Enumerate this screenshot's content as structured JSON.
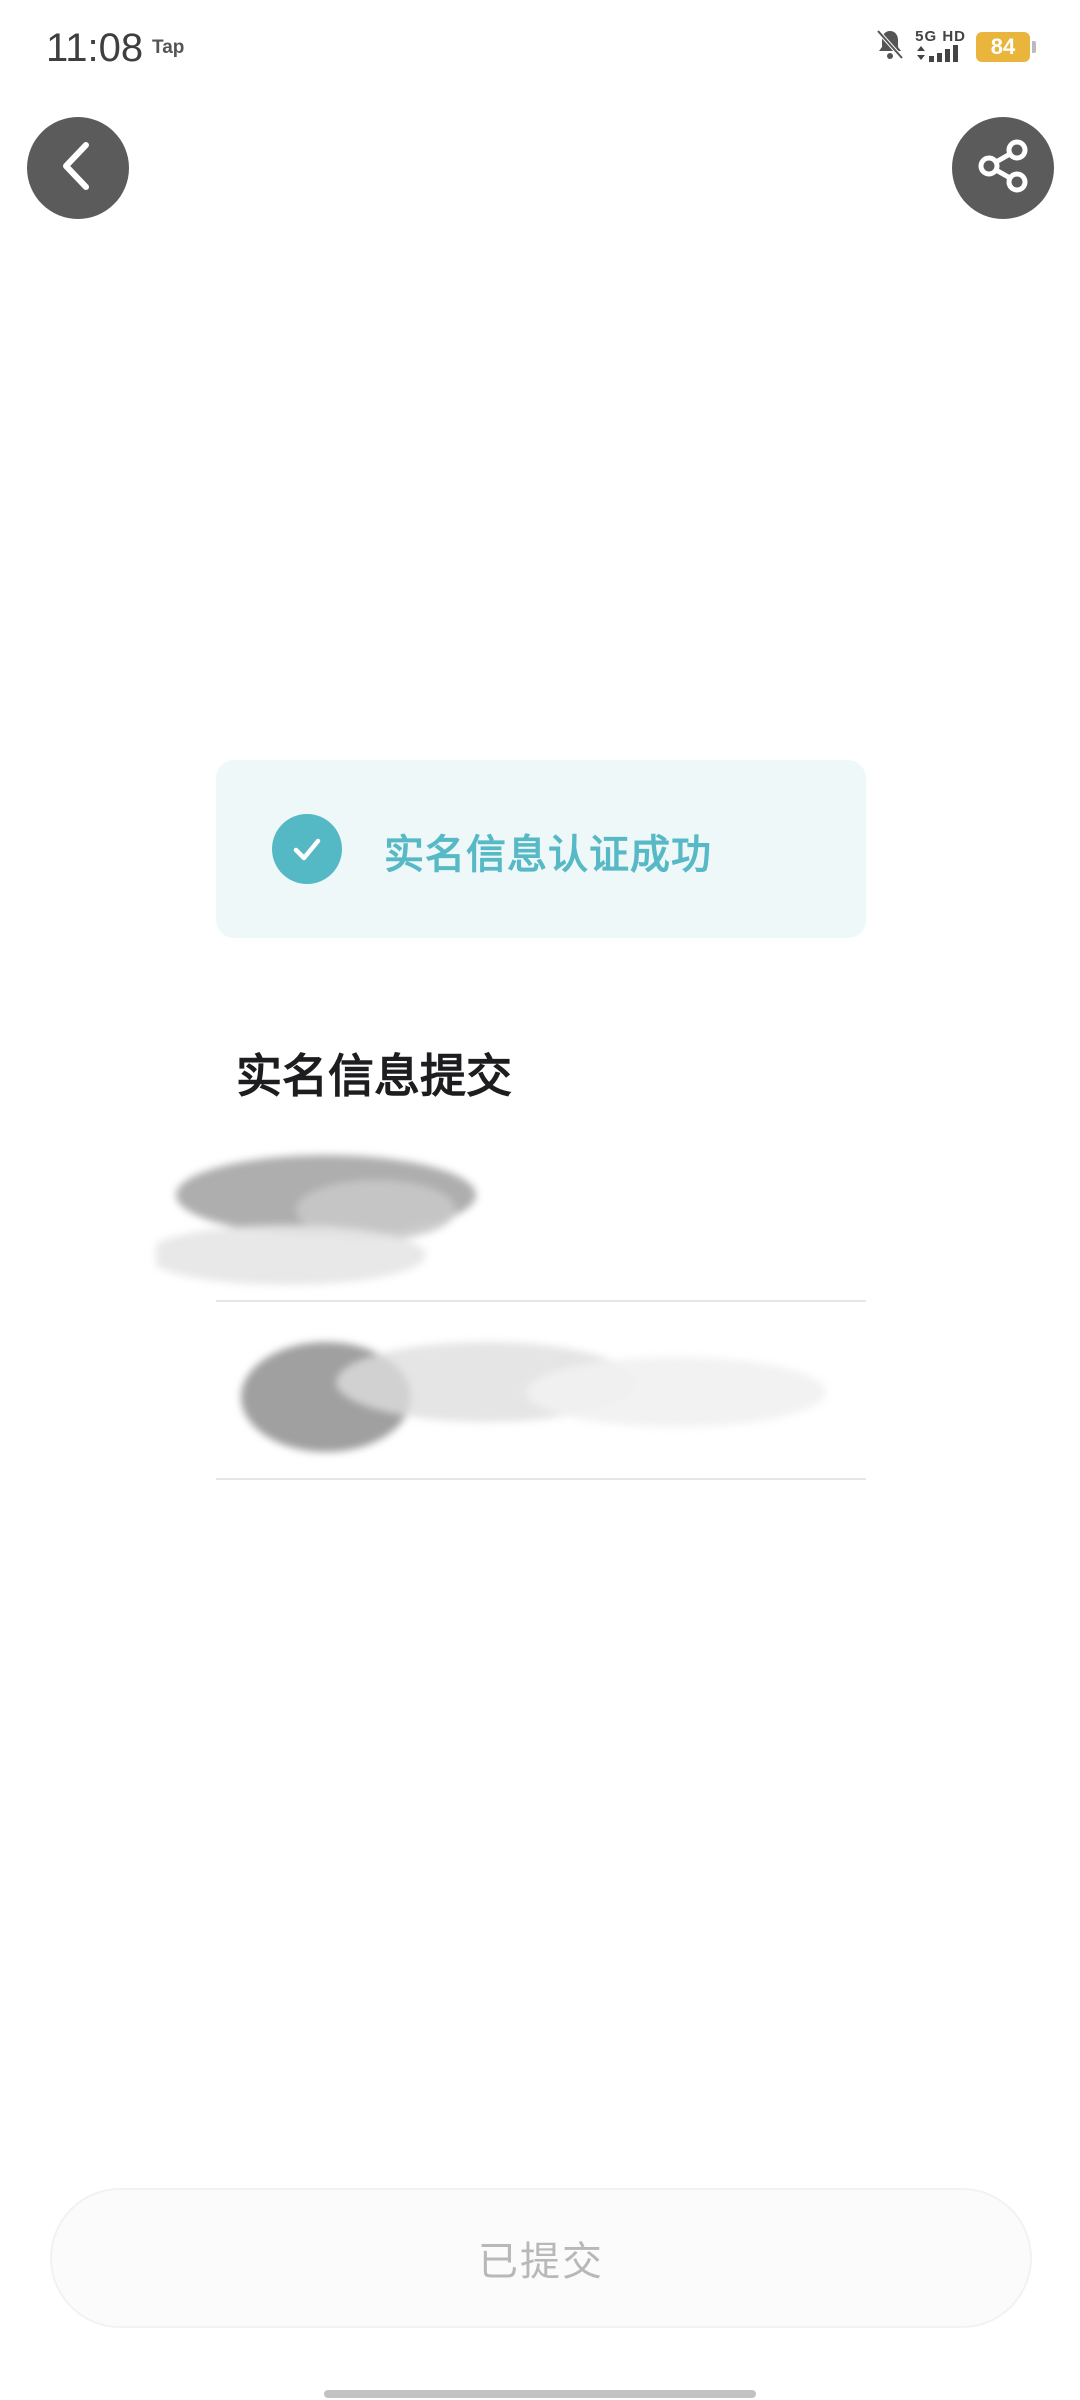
{
  "status_bar": {
    "time": "11:08",
    "carrier_tag": "Tap",
    "network_label": "5G HD",
    "battery_level": "84",
    "battery_color": "#e9b53c",
    "icons": [
      "bell-muted-icon",
      "signal-icon",
      "battery-icon"
    ]
  },
  "nav": {
    "back_icon": "chevron-left-icon",
    "share_icon": "share-icon"
  },
  "banner": {
    "text": "实名信息认证成功",
    "accent_color": "#57b9c5",
    "background_color": "#eef8f9",
    "icon": "check-icon"
  },
  "section": {
    "title": "实名信息提交"
  },
  "footer": {
    "submitted_label": "已提交"
  }
}
